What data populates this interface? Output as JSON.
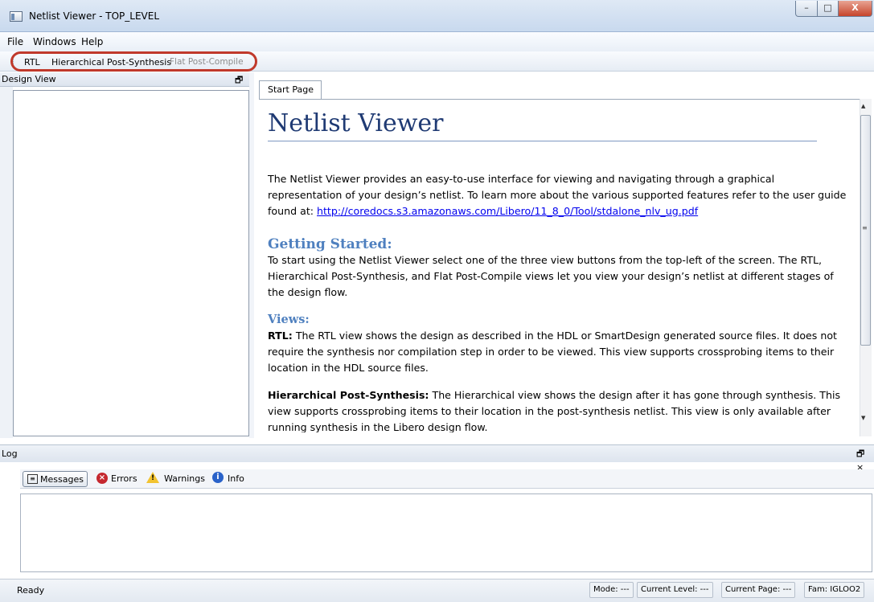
{
  "window": {
    "title": "Netlist Viewer - TOP_LEVEL",
    "minimize": "–",
    "maximize": "□",
    "close": "X"
  },
  "menu": [
    "File",
    "Windows",
    "Help"
  ],
  "toolbar": {
    "rtl": "RTL",
    "hierarchical": "Hierarchical Post-Synthesis",
    "flat": "Flat Post-Compile"
  },
  "design_view": {
    "title": "Design View"
  },
  "tabs": {
    "start_page": "Start Page"
  },
  "doc": {
    "title": "Netlist Viewer",
    "intro": "The Netlist Viewer provides an easy-to-use interface for viewing and navigating through a graphical representation of your design’s netlist. To learn more about the various supported features refer to the user guide found at:",
    "link": "http://coredocs.s3.amazonaws.com/Libero/11_8_0/Tool/stdalone_nlv_ug.pdf",
    "getting_started_heading": "Getting Started:",
    "getting_started_text": "To start using the Netlist Viewer select one of the three view buttons from the top-left of the screen. The RTL, Hierarchical Post-Synthesis, and Flat Post-Compile views let you view your design’s netlist at different stages of the design flow.",
    "views_heading": "Views:",
    "rtl_label": "RTL:",
    "rtl_text": "The RTL view shows the design as described in the HDL or SmartDesign generated source files. It does not require the synthesis nor compilation step in order to be viewed. This view supports crossprobing items to their location in the HDL source files.",
    "hier_label": "Hierarchical Post-Synthesis:",
    "hier_text": "The Hierarchical view shows the design after it has gone through synthesis. This view supports crossprobing items to their location in the post-synthesis netlist. This view is only available after running synthesis in the Libero design flow."
  },
  "log": {
    "title": "Log",
    "controls": "🗗 ×",
    "tabs": {
      "messages": "Messages",
      "errors": "Errors",
      "warnings": "Warnings",
      "info": "Info"
    }
  },
  "status": {
    "ready": "Ready",
    "mode": "Mode: ---",
    "current_level": "Current Level: ---",
    "current_page": "Current Page: ---",
    "fam": "Fam: IGLOO2"
  },
  "colors": {
    "accent": "#1f3a73",
    "heading": "#4f80bf",
    "highlight": "#c0392b"
  }
}
